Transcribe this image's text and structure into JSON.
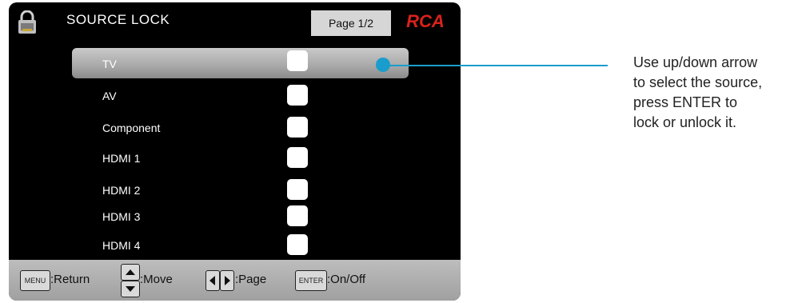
{
  "header": {
    "title": "SOURCE LOCK",
    "page_indicator": "Page 1/2",
    "brand": "RCA",
    "brand_color": "#d8221b"
  },
  "sources": [
    {
      "label": "TV",
      "selected": true
    },
    {
      "label": "AV",
      "selected": false
    },
    {
      "label": "Component",
      "selected": false
    },
    {
      "label": "HDMI 1",
      "selected": false
    },
    {
      "label": "HDMI 2",
      "selected": false
    },
    {
      "label": "HDMI 3",
      "selected": false
    },
    {
      "label": "HDMI 4",
      "selected": false
    }
  ],
  "footer": {
    "menu_key": "MENU",
    "return_hint": ":Return",
    "move_hint": ":Move",
    "page_hint": ":Page",
    "enter_key": "ENTER",
    "onoff_hint": ":On/Off"
  },
  "callout": {
    "text": "Use up/down arrow\nto select the source,\npress ENTER to\nlock or unlock it.",
    "color": "#1a9dcc"
  }
}
